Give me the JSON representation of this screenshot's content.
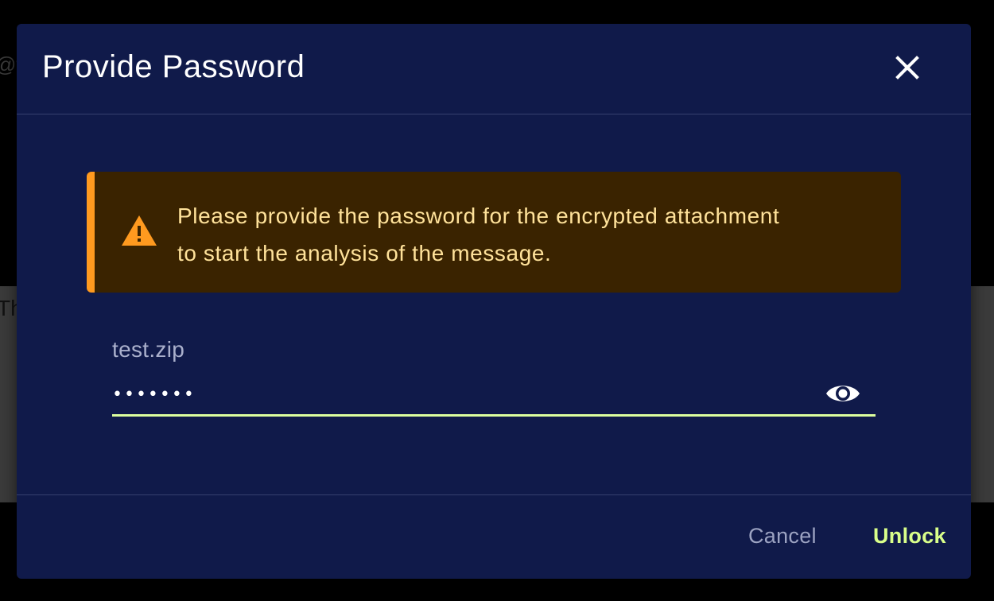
{
  "background": {
    "top_text": "@f",
    "band_text": "Th"
  },
  "dialog": {
    "title": "Provide Password",
    "close_icon": "close-icon",
    "alert": {
      "icon": "warning-icon",
      "message": "Please provide the password for the encrypted attachment to start the analysis of the message.",
      "accent_color": "#ff9a1f",
      "background_color": "#3a2300",
      "text_color": "#ffe29a"
    },
    "field": {
      "label": "test.zip",
      "value": "•••••••",
      "toggle_icon": "eye-icon",
      "underline_color": "#dcff9e"
    },
    "footer": {
      "cancel_label": "Cancel",
      "unlock_label": "Unlock",
      "unlock_color": "#d9ff8a"
    },
    "background_color": "#101a4a"
  }
}
